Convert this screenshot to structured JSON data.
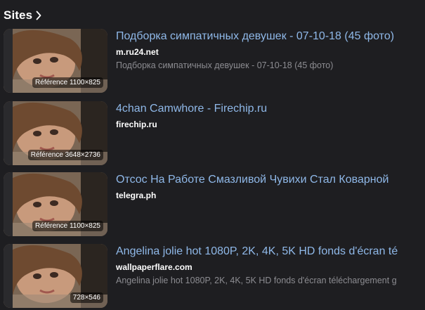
{
  "section": {
    "title": "Sites",
    "chevron_icon": "chevron-right-icon"
  },
  "colors": {
    "background": "#1e1e21",
    "title_link": "#8fb8e8",
    "domain": "#ffffff",
    "snippet": "#8c8c91"
  },
  "results": [
    {
      "title": "Подборка симпатичных девушек - 07-10-18 (45 фото)",
      "domain": "m.ru24.net",
      "snippet": "Подборка симпатичных девушек - 07-10-18 (45 фото)",
      "badge": "Référence 1100×825"
    },
    {
      "title": "4chan Camwhore - Firechip.ru",
      "domain": "firechip.ru",
      "snippet": "",
      "badge": "Référence 3648×2736"
    },
    {
      "title": "Отсос На Работе Смазливой Чувихи Стал Коварной",
      "domain": "telegra.ph",
      "snippet": "",
      "badge": "Référence 1100×825"
    },
    {
      "title": "Angelina jolie hot 1080P, 2K, 4K, 5K HD fonds d'écran té",
      "domain": "wallpaperflare.com",
      "snippet": "Angelina jolie hot 1080P, 2K, 4K, 5K HD fonds d'écran téléchargement g",
      "badge": "728×546"
    }
  ]
}
